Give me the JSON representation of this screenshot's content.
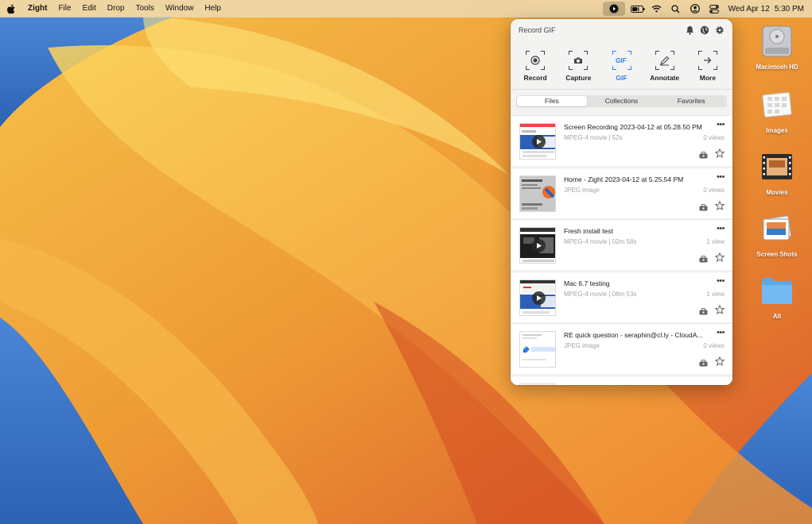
{
  "menubar": {
    "items": [
      "Zight",
      "File",
      "Edit",
      "Drop",
      "Tools",
      "Window",
      "Help"
    ],
    "clock_day": "Wed Apr 12",
    "clock_time": "5:30 PM"
  },
  "desktop": {
    "icons": [
      {
        "label": "Macintosh HD",
        "icon": "hard-drive-icon"
      },
      {
        "label": "Images",
        "icon": "images-folder-icon"
      },
      {
        "label": "Movies",
        "icon": "movies-folder-icon"
      },
      {
        "label": "Screen Shots",
        "icon": "screenshots-folder-icon"
      },
      {
        "label": "All",
        "icon": "folder-icon"
      }
    ]
  },
  "panel": {
    "title": "Record GIF",
    "actions": [
      {
        "label": "Record",
        "icon": "record-icon"
      },
      {
        "label": "Capture",
        "icon": "camera-icon"
      },
      {
        "label": "GIF",
        "icon": "gif-icon",
        "selected": true
      },
      {
        "label": "Annotate",
        "icon": "annotate-icon"
      },
      {
        "label": "More",
        "icon": "arrow-right-icon"
      }
    ],
    "tabs": [
      "Files",
      "Collections",
      "Favorites"
    ],
    "active_tab": "Files",
    "files": [
      {
        "name": "Screen Recording 2023-04-12 at 05.28.50 PM",
        "meta": "MPEG-4 movie | 52s",
        "views": "0 views",
        "video": true
      },
      {
        "name": "Home - Zight 2023-04-12 at 5.25.54 PM",
        "meta": "JPEG image",
        "views": "0 views",
        "video": false
      },
      {
        "name": "Fresh install test",
        "meta": "MPEG-4 movie | 02m 58s",
        "views": "1 view",
        "video": true
      },
      {
        "name": "Mac 6.7 testing",
        "meta": "MPEG-4 movie | 06m 53s",
        "views": "1 view",
        "video": true
      },
      {
        "name": "RE quick question - seraphin@cl.ly - CloudA...",
        "meta": "JPEG image",
        "views": "0 views",
        "video": false
      }
    ]
  },
  "colors": {
    "accent": "#2f80ed",
    "menubar": "#eed7aa",
    "wallpaper_orange": "#e9892d",
    "wallpaper_blue": "#3d78c9"
  }
}
